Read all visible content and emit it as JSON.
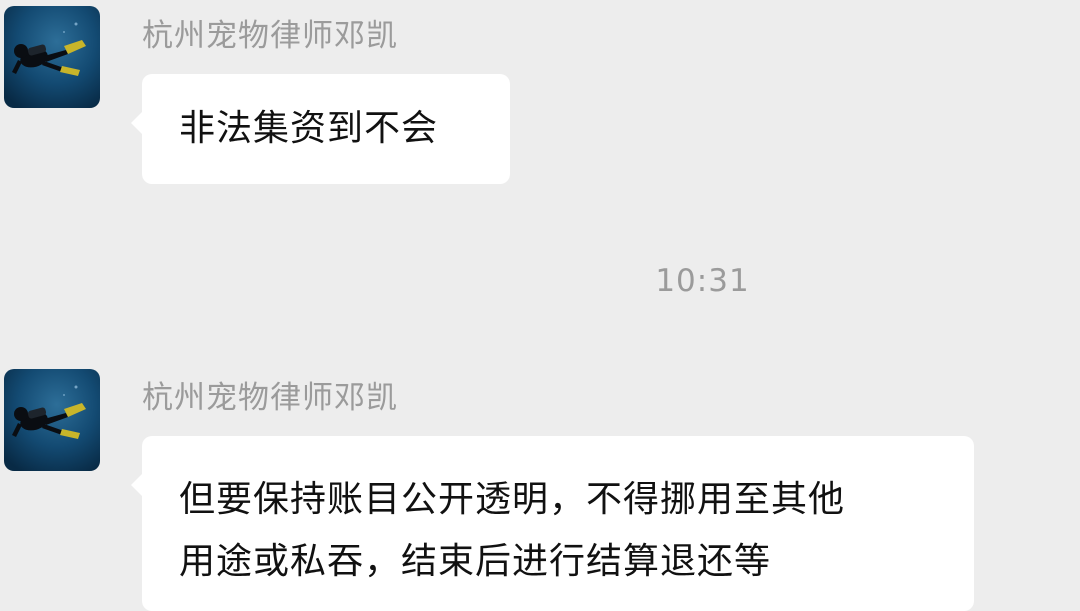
{
  "messages": [
    {
      "sender": "杭州宠物律师邓凯",
      "avatar_icon": "scuba-diver-avatar",
      "lines": [
        "非法集资到不会"
      ]
    },
    {
      "sender": "杭州宠物律师邓凯",
      "avatar_icon": "scuba-diver-avatar",
      "lines": [
        "但要保持账目公开透明，不得挪用至其他",
        "用途或私吞，结束后进行结算退还等"
      ]
    }
  ],
  "timestamp": "10:31",
  "colors": {
    "background": "#ededed",
    "bubble": "#ffffff",
    "sender_text": "#9b9b9b",
    "message_text": "#111111",
    "avatar_water": "#0f3f66"
  }
}
